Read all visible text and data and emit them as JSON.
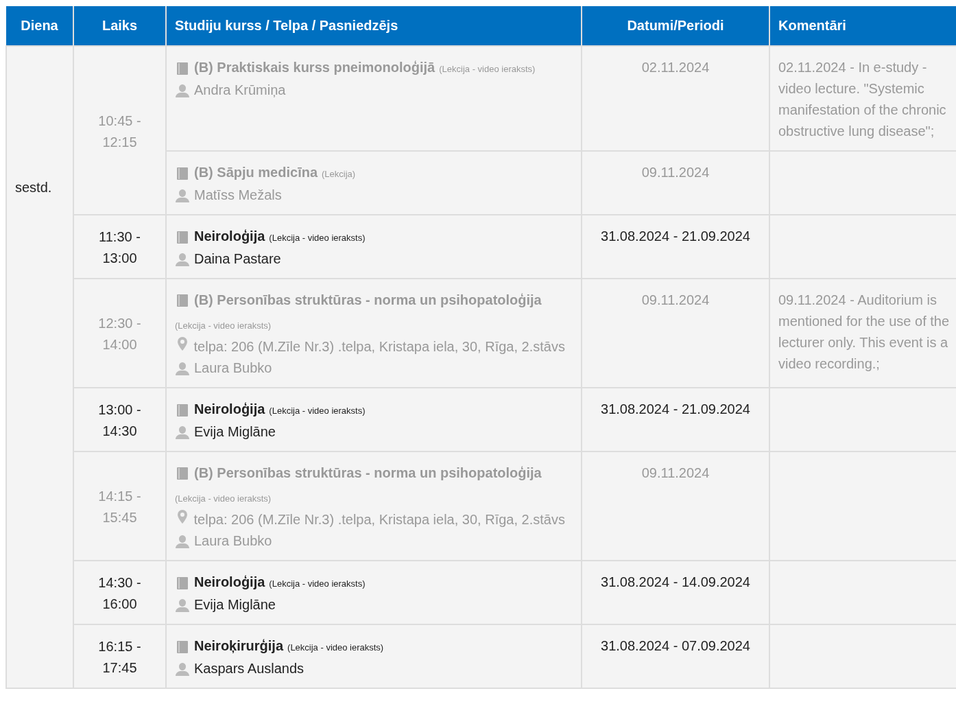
{
  "columns": [
    "Diena",
    "Laiks",
    "Studiju kurss / Telpa / Pasniedzējs",
    "Datumi/Periodi",
    "Komentāri"
  ],
  "day": "sestd.",
  "groups": [
    {
      "time": "10:45 - 12:15",
      "greyed": true,
      "entries": [
        {
          "course": "(B) Praktiskais kurss pneimonoloģijā",
          "type": "(Lekcija - video ieraksts)",
          "teacher": "Andra Krūmiņa",
          "dates": "02.11.2024",
          "comment": "02.11.2024 - In e-study - video lecture. \"Systemic manifestation of the chronic obstructive lung disease\";"
        },
        {
          "course": "(B) Sāpju medicīna",
          "type": "(Lekcija)",
          "teacher": "Matīss Mežals",
          "dates": "09.11.2024"
        }
      ]
    },
    {
      "time": "11:30 - 13:00",
      "greyed": false,
      "entries": [
        {
          "course": "Neiroloģija",
          "type": "(Lekcija - video ieraksts)",
          "teacher": "Daina Pastare",
          "dates": "31.08.2024 - 21.09.2024"
        }
      ]
    },
    {
      "time": "12:30 - 14:00",
      "greyed": true,
      "entries": [
        {
          "course": "(B) Personības struktūras - norma un psihopatoloģija",
          "type": "(Lekcija - video ieraksts)",
          "location": "telpa: 206 (M.Zīle Nr.3) .telpa, Kristapa iela, 30, Rīga, 2.stāvs",
          "teacher": "Laura Bubko",
          "dates": "09.11.2024",
          "comment": "09.11.2024 - Auditorium is mentioned for the use of the lecturer only. This event is a video recording.;"
        }
      ]
    },
    {
      "time": "13:00 - 14:30",
      "greyed": false,
      "entries": [
        {
          "course": "Neiroloģija",
          "type": "(Lekcija - video ieraksts)",
          "teacher": "Evija Miglāne",
          "dates": "31.08.2024 - 21.09.2024"
        }
      ]
    },
    {
      "time": "14:15 - 15:45",
      "greyed": true,
      "entries": [
        {
          "course": "(B) Personības struktūras - norma un psihopatoloģija",
          "type": "(Lekcija - video ieraksts)",
          "location": "telpa: 206 (M.Zīle Nr.3) .telpa, Kristapa iela, 30, Rīga, 2.stāvs",
          "teacher": "Laura Bubko",
          "dates": "09.11.2024"
        }
      ]
    },
    {
      "time": "14:30 - 16:00",
      "greyed": false,
      "entries": [
        {
          "course": "Neiroloģija",
          "type": "(Lekcija - video ieraksts)",
          "teacher": "Evija Miglāne",
          "dates": "31.08.2024 - 14.09.2024"
        }
      ]
    },
    {
      "time": "16:15 - 17:45",
      "greyed": false,
      "entries": [
        {
          "course": "Neiroķirurģija",
          "type": "(Lekcija - video ieraksts)",
          "teacher": "Kaspars Auslands",
          "dates": "31.08.2024 - 07.09.2024"
        }
      ]
    }
  ]
}
